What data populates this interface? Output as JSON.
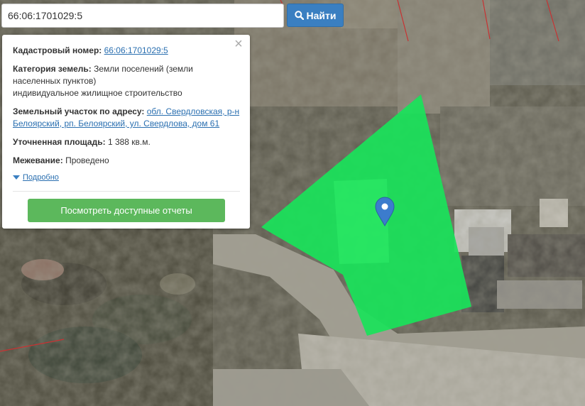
{
  "search": {
    "value": "66:06:1701029:5",
    "button_label": "Найти"
  },
  "popup": {
    "cadastral_label": "Кадастровый номер:",
    "cadastral_value": "66:06:1701029:5",
    "category_label": "Категория земель:",
    "category_value": "Земли поселений (земли\nнаселенных пунктов)\nиндивидуальное жилищное строительство",
    "address_label": "Земельный участок по адресу:",
    "address_value": "обл. Свердловская, р-н Белоярский, рп. Белоярский, ул. Свердлова, дом 61",
    "area_label": "Уточненная площадь:",
    "area_value": "1 388 кв.м.",
    "survey_label": "Межевание:",
    "survey_value": "Проведено",
    "more_label": "Подробно",
    "reports_button": "Посмотреть доступные отчеты"
  },
  "colors": {
    "parcel": "#19e35a",
    "search_button": "#3a7fc1",
    "reports_button": "#5cb85c",
    "marker": "#3c7ccd",
    "boundary_lines": "#c83232"
  },
  "icons": {
    "search": "search-icon",
    "close": "close-icon",
    "expand": "triangle-down-icon",
    "marker": "map-marker-icon"
  }
}
